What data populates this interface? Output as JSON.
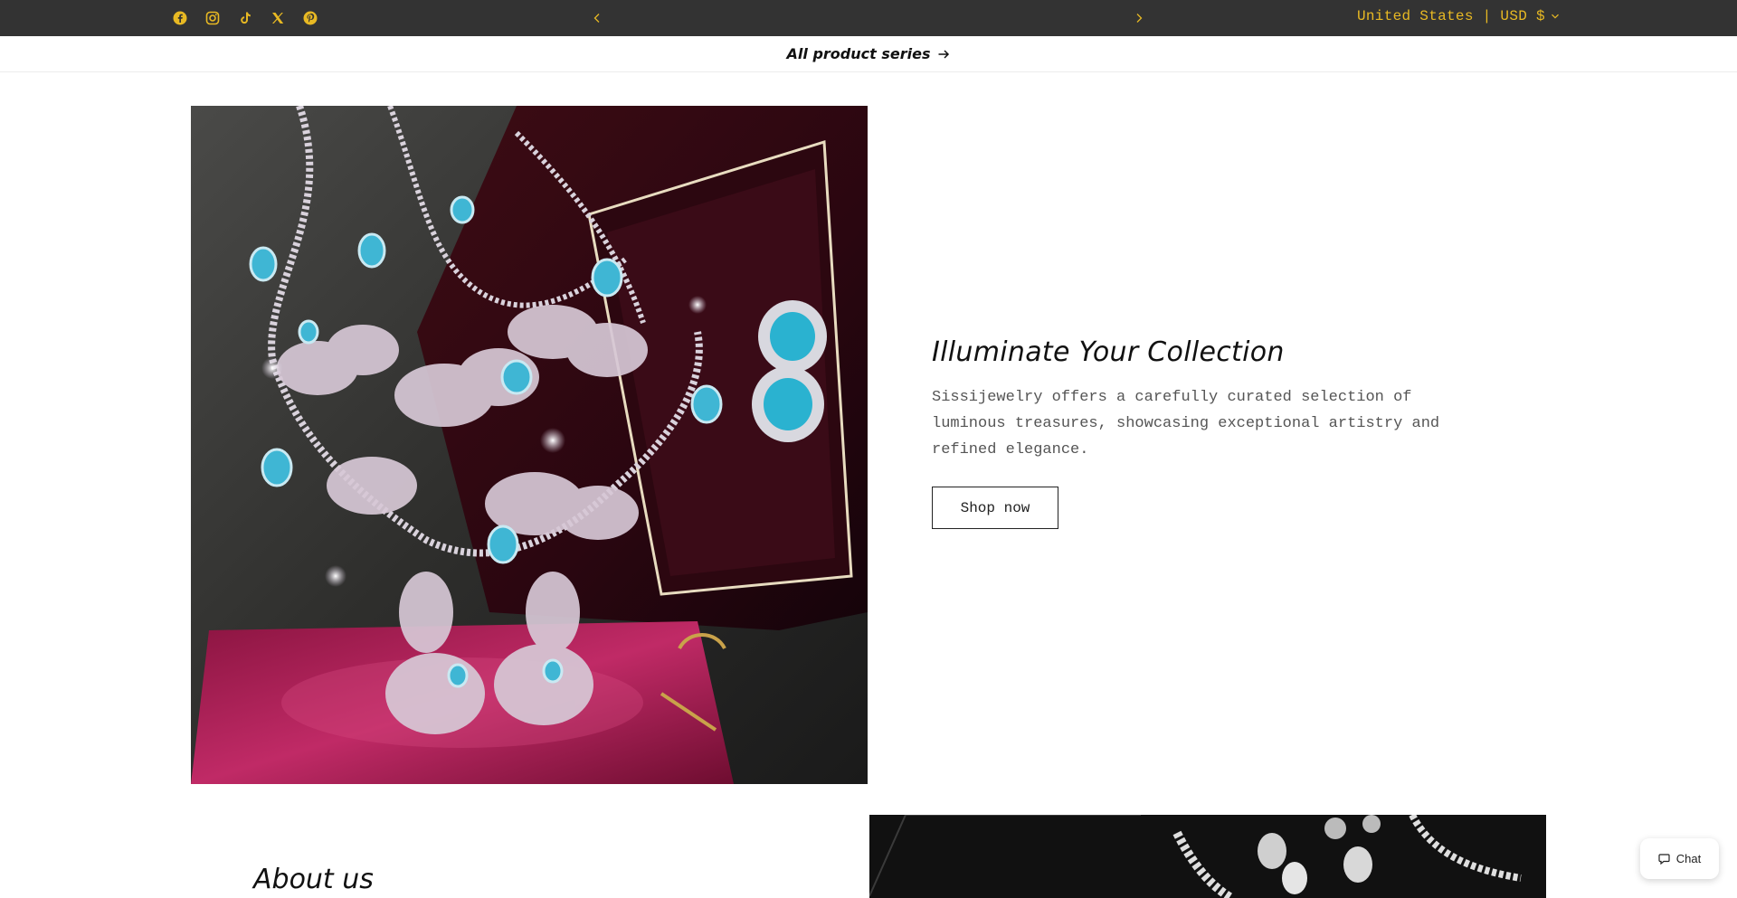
{
  "topbar": {
    "social_icons": [
      "facebook-icon",
      "instagram-icon",
      "tiktok-icon",
      "x-icon",
      "pinterest-icon"
    ],
    "locale_label": "United States | USD $",
    "accent_color": "#e8b923",
    "background_color": "#333333"
  },
  "subbar": {
    "link_label": "All product series"
  },
  "hero": {
    "title": "Illuminate Your Collection",
    "description": "Sissijewelry offers a carefully curated selection of luminous treasures, showcasing exceptional artistry and refined elegance.",
    "button_label": "Shop now"
  },
  "about": {
    "title": "About us"
  },
  "chat": {
    "label": "Chat"
  }
}
